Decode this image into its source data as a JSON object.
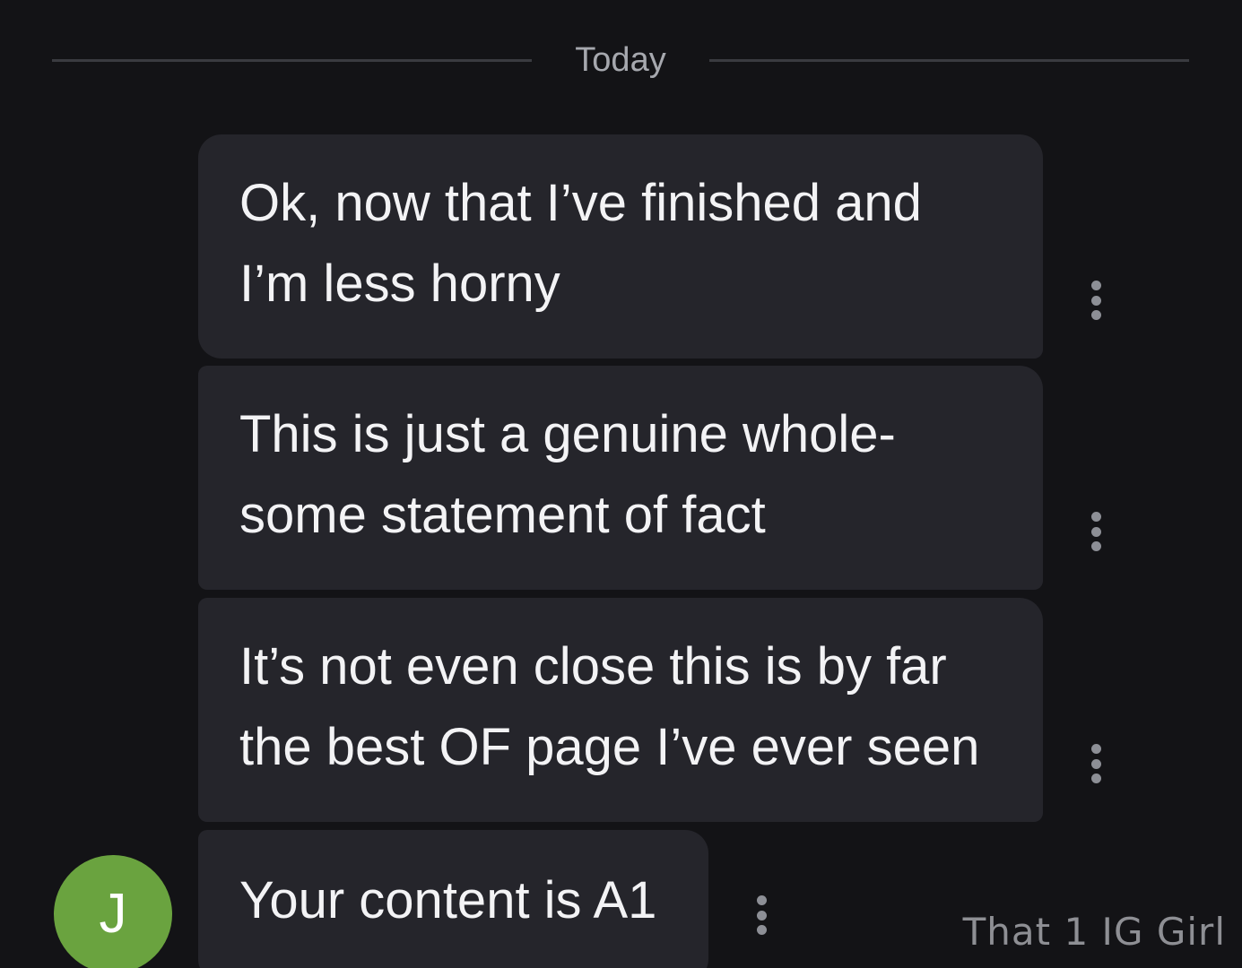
{
  "date_divider": "Today",
  "messages": [
    {
      "text": "Ok, now that I’ve finished and\nI’m less horny"
    },
    {
      "text": "This is just a genuine whole-\nsome statement of fact"
    },
    {
      "text": "It’s not even close this is by far\nthe best OF page I’ve ever seen"
    },
    {
      "text": "Your content is A1"
    }
  ],
  "avatar": {
    "initial": "J",
    "color": "#6aa33f"
  },
  "watermark": "That 1 IG Girl",
  "icons": {
    "message_options": "more-vertical-icon"
  },
  "colors": {
    "background": "#131316",
    "bubble": "#25252b",
    "text": "#f3f3f5",
    "muted": "#a6a8ae"
  }
}
